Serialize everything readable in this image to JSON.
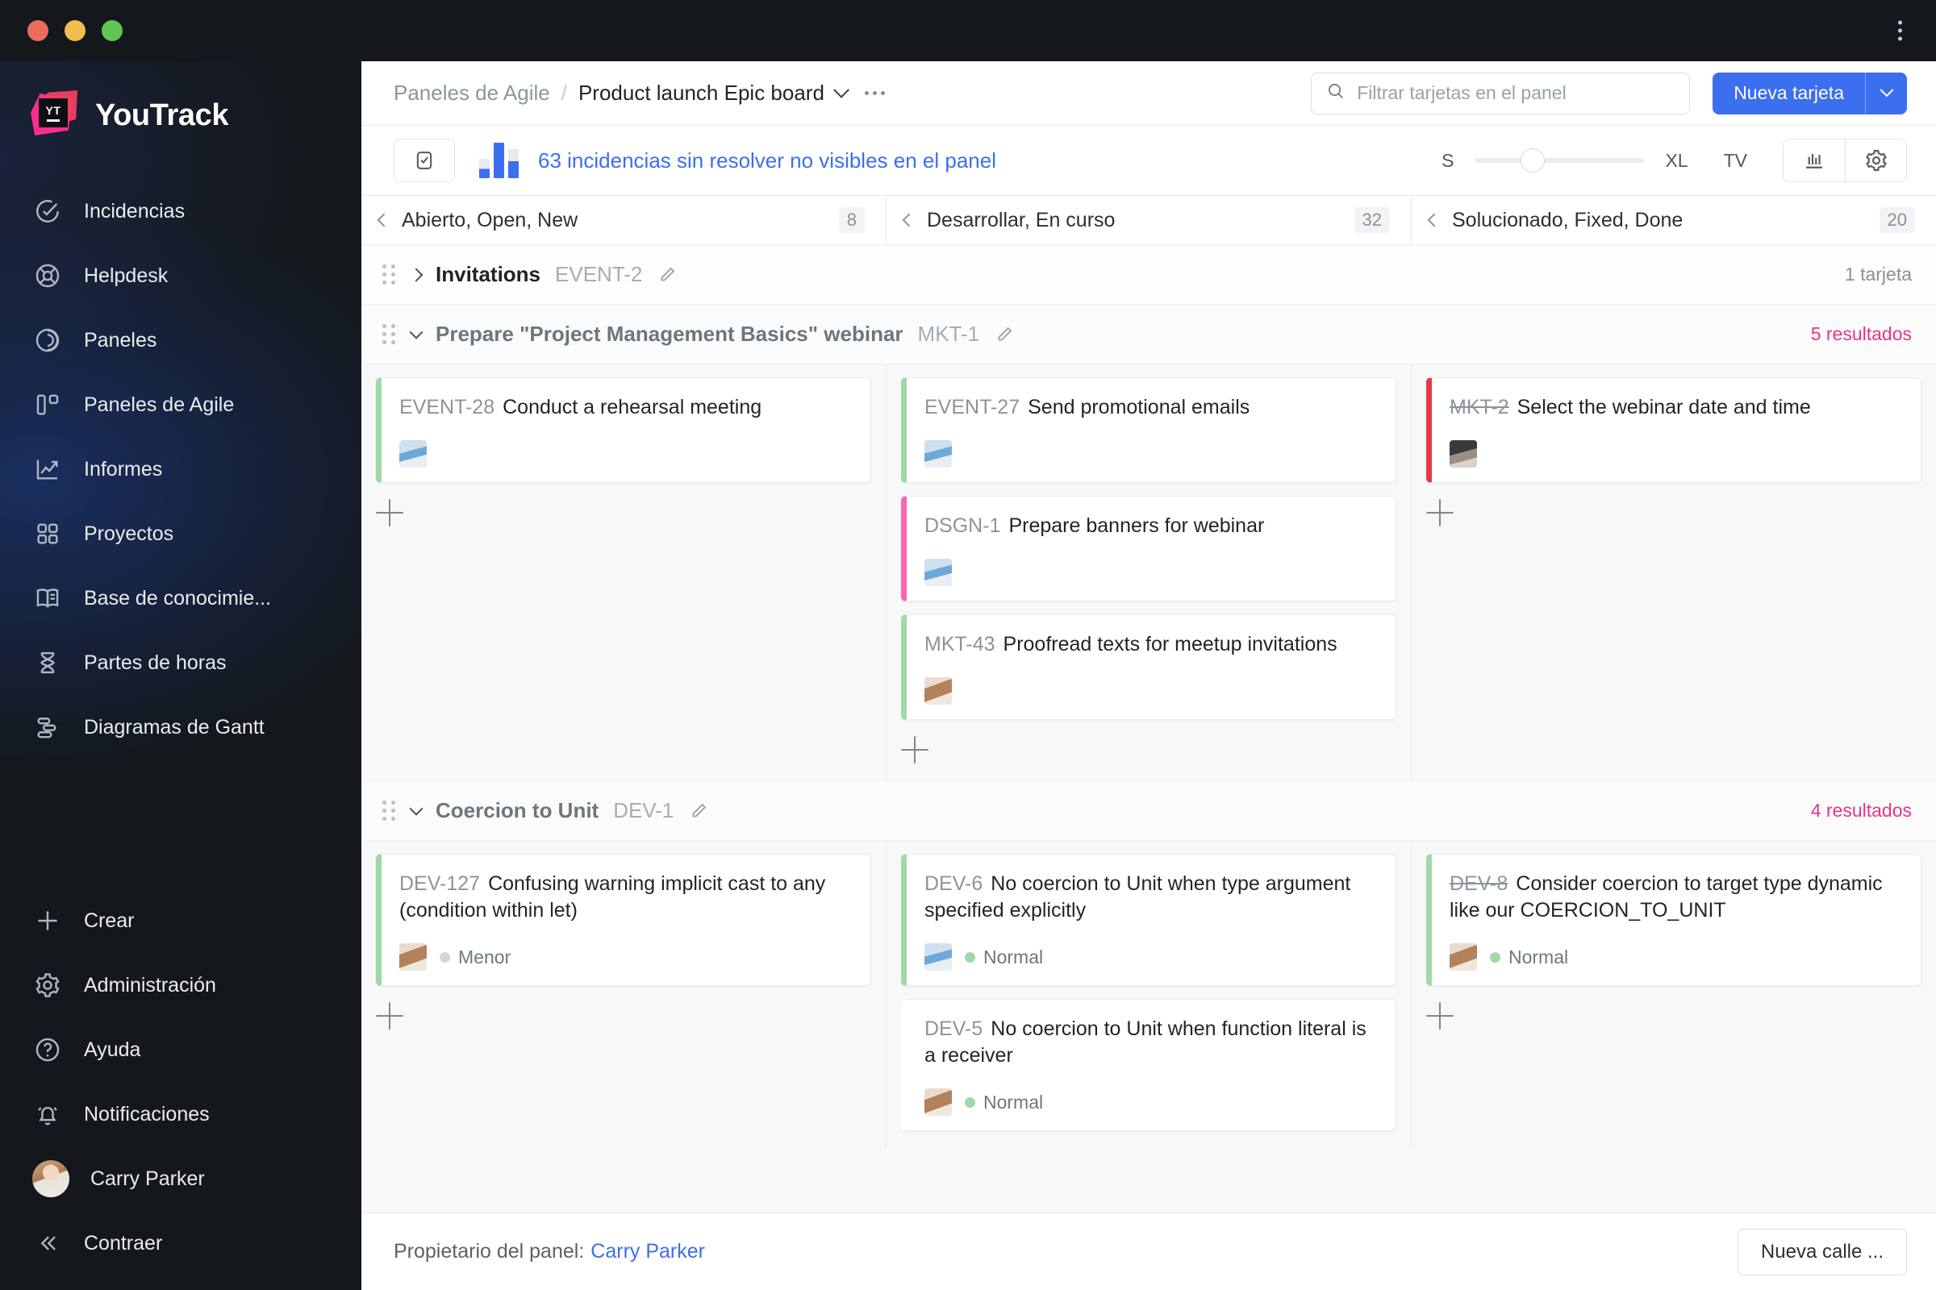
{
  "window": {
    "traffic_lights": [
      "close",
      "minimize",
      "zoom"
    ],
    "overflow_menu": "more-options"
  },
  "sidebar": {
    "brand": {
      "logo_text": "YT",
      "name": "YouTrack"
    },
    "items": [
      {
        "label": "Incidencias",
        "icon": "check-circle-icon"
      },
      {
        "label": "Helpdesk",
        "icon": "lifebuoy-icon"
      },
      {
        "label": "Paneles",
        "icon": "dashboard-icon"
      },
      {
        "label": "Paneles de Agile",
        "icon": "agile-board-icon"
      },
      {
        "label": "Informes",
        "icon": "chart-line-icon"
      },
      {
        "label": "Proyectos",
        "icon": "grid-icon"
      },
      {
        "label": "Base de conocimie...",
        "icon": "book-icon"
      },
      {
        "label": "Partes de horas",
        "icon": "hourglass-icon"
      },
      {
        "label": "Diagramas de Gantt",
        "icon": "gantt-icon"
      }
    ],
    "bottom_items": [
      {
        "label": "Crear",
        "icon": "plus-icon"
      },
      {
        "label": "Administración",
        "icon": "gear-icon"
      },
      {
        "label": "Ayuda",
        "icon": "question-circle-icon"
      },
      {
        "label": "Notificaciones",
        "icon": "bell-icon"
      }
    ],
    "user": {
      "name": "Carry Parker",
      "icon": "avatar"
    },
    "collapse": {
      "label": "Contraer",
      "icon": "chevrons-left-icon"
    }
  },
  "topbar": {
    "breadcrumb_parent": "Paneles de Agile",
    "breadcrumb_separator": "/",
    "breadcrumb_current": "Product launch Epic board",
    "board_menu_icon": "chevron-down-icon",
    "more_icon": "ellipsis-icon",
    "search": {
      "placeholder": "Filtrar tarjetas en el panel",
      "value": "",
      "icon": "search-icon"
    },
    "new_card_label": "Nueva tarjeta",
    "new_card_split_icon": "chevron-down-icon"
  },
  "toolbar": {
    "archive_icon": "inbox-check-icon",
    "chart_icon": "bar-chart-icon",
    "unresolved_text": "63 incidencias sin resolver no visibles en el panel",
    "size_min": "S",
    "size_max": "XL",
    "tv_label": "TV",
    "slider_position_pct": 34,
    "chart_view_icon": "chart-columns-icon",
    "settings_icon": "gear-icon"
  },
  "columns": [
    {
      "title": "Abierto, Open, New",
      "count": "8"
    },
    {
      "title": "Desarrollar, En curso",
      "count": "32"
    },
    {
      "title": "Solucionado, Fixed, Done",
      "count": "20"
    }
  ],
  "swimlanes": [
    {
      "title": "Invitations",
      "id": "EVENT-2",
      "collapsed": true,
      "right_text": "1 tarjeta",
      "right_style": "gray",
      "cards": [
        [],
        [],
        []
      ]
    },
    {
      "title": "Prepare \"Project Management Basics\" webinar",
      "id": "MKT-1",
      "collapsed": false,
      "right_text": "5 resultados",
      "right_style": "pink",
      "cards": [
        [
          {
            "id": "EVENT-28",
            "title": "Conduct a rehearsal meeting",
            "accent": "#9fd9a8",
            "avatar": "a1",
            "priority": "",
            "priority_class": "",
            "done": false
          }
        ],
        [
          {
            "id": "EVENT-27",
            "title": "Send promotional emails",
            "accent": "#9fd9a8",
            "avatar": "a1",
            "priority": "",
            "priority_class": "",
            "done": false
          },
          {
            "id": "DSGN-1",
            "title": "Prepare banners for webinar",
            "accent": "#f768b0",
            "avatar": "a1",
            "priority": "",
            "priority_class": "",
            "done": false
          },
          {
            "id": "MKT-43",
            "title": "Proofread texts for meetup invitations",
            "accent": "#9fd9a8",
            "avatar": "a2",
            "priority": "",
            "priority_class": "",
            "done": false
          }
        ],
        [
          {
            "id": "MKT-2",
            "title": "Select the webinar date and time",
            "accent": "#e8394a",
            "avatar": "a3",
            "priority": "",
            "priority_class": "",
            "done": true
          }
        ]
      ]
    },
    {
      "title": "Coercion to Unit",
      "id": "DEV-1",
      "collapsed": false,
      "right_text": "4 resultados",
      "right_style": "pink",
      "cards": [
        [
          {
            "id": "DEV-127",
            "title": "Confusing warning implicit cast to any (condition within let)",
            "accent": "#9fd9a8",
            "avatar": "a2",
            "priority": "Menor",
            "priority_class": "minor",
            "done": false
          }
        ],
        [
          {
            "id": "DEV-6",
            "title": "No coercion to Unit when type argument specified explicitly",
            "accent": "#9fd9a8",
            "avatar": "a1",
            "priority": "Normal",
            "priority_class": "normal",
            "done": false
          },
          {
            "id": "DEV-5",
            "title": "No coercion to Unit when function literal is a receiver",
            "accent": "#ffffff",
            "avatar": "a2",
            "priority": "Normal",
            "priority_class": "normal",
            "done": false
          }
        ],
        [
          {
            "id": "DEV-8",
            "title": "Consider coercion to target type dynamic like our COERCION_TO_UNIT",
            "accent": "#9fd9a8",
            "avatar": "a2",
            "priority": "Normal",
            "priority_class": "normal",
            "done": true
          }
        ]
      ]
    }
  ],
  "add_card_icon": "plus-icon",
  "footer": {
    "owner_label": "Propietario del panel:",
    "owner_name": "Carry Parker",
    "new_swimlane_label": "Nueva calle ..."
  },
  "colors": {
    "accent_blue": "#3c6ef0",
    "pink": "#e8357f",
    "green": "#9fd9a8",
    "red": "#e8394a"
  }
}
